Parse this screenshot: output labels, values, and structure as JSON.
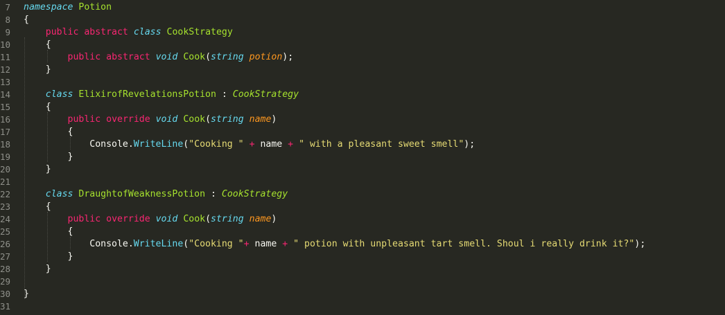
{
  "editor": {
    "line_numbers": [
      "7",
      "8",
      "9",
      "10",
      "11",
      "12",
      "13",
      "14",
      "15",
      "16",
      "17",
      "18",
      "19",
      "20",
      "21",
      "22",
      "23",
      "24",
      "25",
      "26",
      "27",
      "28",
      "29",
      "30",
      "31"
    ],
    "lines": [
      [
        {
          "t": "namespace",
          "c": "st"
        },
        {
          "t": " ",
          "c": "sp"
        },
        {
          "t": "Potion",
          "c": "cn"
        }
      ],
      [
        {
          "t": "{",
          "c": "tx"
        }
      ],
      [
        {
          "t": "    ",
          "c": "sp"
        },
        {
          "t": "public",
          "c": "kw"
        },
        {
          "t": " ",
          "c": "sp"
        },
        {
          "t": "abstract",
          "c": "kw"
        },
        {
          "t": " ",
          "c": "sp"
        },
        {
          "t": "class",
          "c": "st"
        },
        {
          "t": " ",
          "c": "sp"
        },
        {
          "t": "CookStrategy",
          "c": "cn"
        }
      ],
      [
        {
          "t": "    {",
          "c": "tx"
        }
      ],
      [
        {
          "t": "        ",
          "c": "sp"
        },
        {
          "t": "public",
          "c": "kw"
        },
        {
          "t": " ",
          "c": "sp"
        },
        {
          "t": "abstract",
          "c": "kw"
        },
        {
          "t": " ",
          "c": "sp"
        },
        {
          "t": "void",
          "c": "st"
        },
        {
          "t": " ",
          "c": "sp"
        },
        {
          "t": "Cook",
          "c": "fn"
        },
        {
          "t": "(",
          "c": "tx"
        },
        {
          "t": "string",
          "c": "st"
        },
        {
          "t": " ",
          "c": "sp"
        },
        {
          "t": "potion",
          "c": "pa"
        },
        {
          "t": ");",
          "c": "tx"
        }
      ],
      [
        {
          "t": "    }",
          "c": "tx"
        }
      ],
      [],
      [
        {
          "t": "    ",
          "c": "sp"
        },
        {
          "t": "class",
          "c": "st"
        },
        {
          "t": " ",
          "c": "sp"
        },
        {
          "t": "ElixirofRevelationsPotion",
          "c": "cn"
        },
        {
          "t": " : ",
          "c": "tx"
        },
        {
          "t": "CookStrategy",
          "c": "ci"
        }
      ],
      [
        {
          "t": "    {",
          "c": "tx"
        }
      ],
      [
        {
          "t": "        ",
          "c": "sp"
        },
        {
          "t": "public",
          "c": "kw"
        },
        {
          "t": " ",
          "c": "sp"
        },
        {
          "t": "override",
          "c": "kw"
        },
        {
          "t": " ",
          "c": "sp"
        },
        {
          "t": "void",
          "c": "st"
        },
        {
          "t": " ",
          "c": "sp"
        },
        {
          "t": "Cook",
          "c": "fn"
        },
        {
          "t": "(",
          "c": "tx"
        },
        {
          "t": "string",
          "c": "st"
        },
        {
          "t": " ",
          "c": "sp"
        },
        {
          "t": "name",
          "c": "pa"
        },
        {
          "t": ")",
          "c": "tx"
        }
      ],
      [
        {
          "t": "        {",
          "c": "tx"
        }
      ],
      [
        {
          "t": "            Console.",
          "c": "tx"
        },
        {
          "t": "WriteLine",
          "c": "me"
        },
        {
          "t": "(",
          "c": "tx"
        },
        {
          "t": "\"Cooking \"",
          "c": "str"
        },
        {
          "t": " ",
          "c": "sp"
        },
        {
          "t": "+",
          "c": "op"
        },
        {
          "t": " name ",
          "c": "tx"
        },
        {
          "t": "+",
          "c": "op"
        },
        {
          "t": " ",
          "c": "sp"
        },
        {
          "t": "\" with a pleasant sweet smell\"",
          "c": "str"
        },
        {
          "t": ");",
          "c": "tx"
        }
      ],
      [
        {
          "t": "        }",
          "c": "tx"
        }
      ],
      [
        {
          "t": "    }",
          "c": "tx"
        }
      ],
      [],
      [
        {
          "t": "    ",
          "c": "sp"
        },
        {
          "t": "class",
          "c": "st"
        },
        {
          "t": " ",
          "c": "sp"
        },
        {
          "t": "DraughtofWeaknessPotion",
          "c": "cn"
        },
        {
          "t": " : ",
          "c": "tx"
        },
        {
          "t": "CookStrategy",
          "c": "ci"
        }
      ],
      [
        {
          "t": "    {",
          "c": "tx"
        }
      ],
      [
        {
          "t": "        ",
          "c": "sp"
        },
        {
          "t": "public",
          "c": "kw"
        },
        {
          "t": " ",
          "c": "sp"
        },
        {
          "t": "override",
          "c": "kw"
        },
        {
          "t": " ",
          "c": "sp"
        },
        {
          "t": "void",
          "c": "st"
        },
        {
          "t": " ",
          "c": "sp"
        },
        {
          "t": "Cook",
          "c": "fn"
        },
        {
          "t": "(",
          "c": "tx"
        },
        {
          "t": "string",
          "c": "st"
        },
        {
          "t": " ",
          "c": "sp"
        },
        {
          "t": "name",
          "c": "pa"
        },
        {
          "t": ")",
          "c": "tx"
        }
      ],
      [
        {
          "t": "        {",
          "c": "tx"
        }
      ],
      [
        {
          "t": "            Console.",
          "c": "tx"
        },
        {
          "t": "WriteLine",
          "c": "me"
        },
        {
          "t": "(",
          "c": "tx"
        },
        {
          "t": "\"Cooking \"",
          "c": "str"
        },
        {
          "t": "+",
          "c": "op"
        },
        {
          "t": " name ",
          "c": "tx"
        },
        {
          "t": "+",
          "c": "op"
        },
        {
          "t": " ",
          "c": "sp"
        },
        {
          "t": "\" potion with unpleasant tart smell. Shoul i really drink it?\"",
          "c": "str"
        },
        {
          "t": ");",
          "c": "tx"
        }
      ],
      [
        {
          "t": "        }",
          "c": "tx"
        }
      ],
      [
        {
          "t": "    }",
          "c": "tx"
        }
      ],
      [],
      [
        {
          "t": "}",
          "c": "tx"
        }
      ],
      []
    ]
  },
  "theme": {
    "background": "#272822",
    "keyword": "#f92672",
    "storage": "#66d9ef",
    "class_name": "#a6e22e",
    "parameter": "#fd971f",
    "string": "#e6db74",
    "text": "#f8f8f2",
    "line_number": "#8f908a"
  }
}
